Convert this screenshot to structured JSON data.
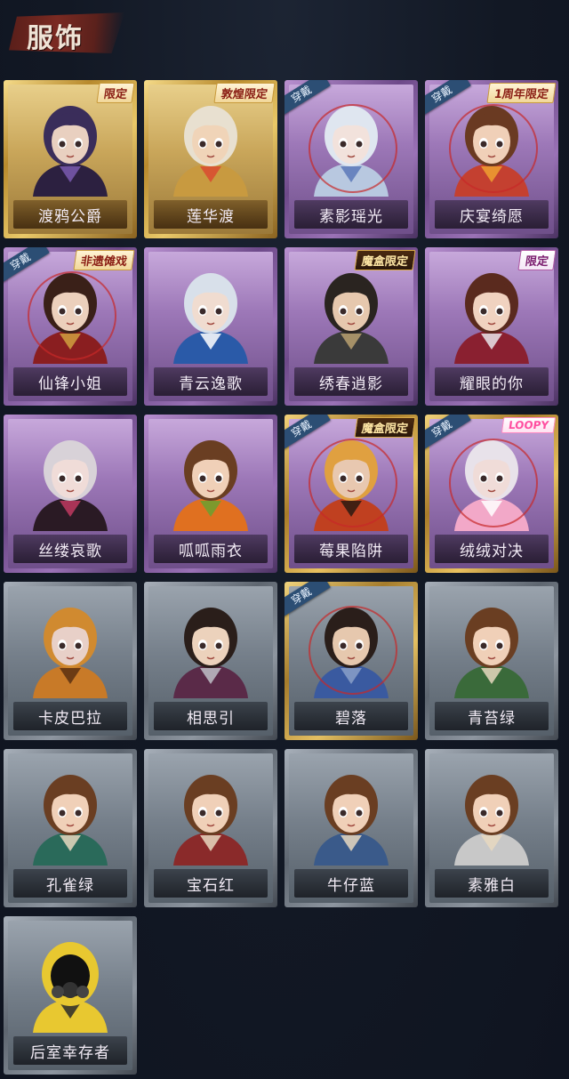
{
  "header": {
    "title": "服饰"
  },
  "cards": [
    {
      "name": "渡鸦公爵",
      "rarity": "gold",
      "badge": "限定",
      "badge_style": "light",
      "equipped": false,
      "hair": "#3a2d5a",
      "skin": "#e9d0c0",
      "cloth": "#2c2040",
      "accent": "#7a5ab0"
    },
    {
      "name": "莲华渡",
      "rarity": "gold",
      "badge": "敦煌限定",
      "badge_style": "light",
      "equipped": false,
      "hair": "#e8e0d0",
      "skin": "#f0d4b8",
      "cloth": "#c89a40",
      "accent": "#d94a30"
    },
    {
      "name": "素影瑶光",
      "rarity": "purple",
      "badge": "",
      "badge_style": "",
      "equipped": true,
      "hair": "#dfe6f0",
      "skin": "#f2e2dc",
      "cloth": "#b8c8e0",
      "accent": "#5a78b8"
    },
    {
      "name": "庆宴绮愿",
      "rarity": "purple",
      "badge": "1周年限定",
      "badge_style": "light",
      "equipped": true,
      "hair": "#6a3a22",
      "skin": "#f0d0b8",
      "cloth": "#c44030",
      "accent": "#f0a030"
    },
    {
      "name": "仙锋小姐",
      "rarity": "purple",
      "badge": "非遗傩戏",
      "badge_style": "light",
      "equipped": true,
      "hair": "#3a2018",
      "skin": "#ecd0bc",
      "cloth": "#8a1e20",
      "accent": "#d0a040"
    },
    {
      "name": "青云逸歌",
      "rarity": "purple",
      "badge": "",
      "badge_style": "",
      "equipped": false,
      "hair": "#d8e0ea",
      "skin": "#f0dcd0",
      "cloth": "#2a5aa8",
      "accent": "#ffffff"
    },
    {
      "name": "绣春逍影",
      "rarity": "purple",
      "badge": "魔盒限定",
      "badge_style": "dark",
      "equipped": false,
      "hair": "#2a2420",
      "skin": "#e6c8ae",
      "cloth": "#3a3a3a",
      "accent": "#b8a070"
    },
    {
      "name": "耀眼的你",
      "rarity": "purple",
      "badge": "限定",
      "badge_style": "purple",
      "equipped": false,
      "hair": "#5a2a1e",
      "skin": "#f0d2c0",
      "cloth": "#8a2030",
      "accent": "#e8e6ea"
    },
    {
      "name": "丝缕哀歌",
      "rarity": "purple",
      "badge": "",
      "badge_style": "",
      "equipped": false,
      "hair": "#d8d2d8",
      "skin": "#f0dcd8",
      "cloth": "#2a1a24",
      "accent": "#c03a60"
    },
    {
      "name": "呱呱雨衣",
      "rarity": "purple",
      "badge": "",
      "badge_style": "",
      "equipped": false,
      "hair": "#6a3e22",
      "skin": "#f0d0b8",
      "cloth": "#e07020",
      "accent": "#6aa030"
    },
    {
      "name": "莓果陷阱",
      "rarity": "purple",
      "goldedge": true,
      "badge": "魔盒限定",
      "badge_style": "dark",
      "equipped": true,
      "hair": "#e0a040",
      "skin": "#e8c8b0",
      "cloth": "#c04020",
      "accent": "#2a1a12"
    },
    {
      "name": "绒绒对决",
      "rarity": "purple",
      "goldedge": true,
      "badge": "LOOPY",
      "badge_style": "pink",
      "equipped": true,
      "hair": "#e8e2ea",
      "skin": "#f0dcd8",
      "cloth": "#f2a8c8",
      "accent": "#ffffff"
    },
    {
      "name": "卡皮巴拉",
      "rarity": "grey",
      "badge": "",
      "badge_style": "",
      "equipped": false,
      "hair": "#d08a30",
      "skin": "#e8d0c8",
      "cloth": "#c87a28",
      "accent": "#5a3010"
    },
    {
      "name": "相思引",
      "rarity": "grey",
      "badge": "",
      "badge_style": "",
      "equipped": false,
      "hair": "#2a1e1a",
      "skin": "#ecd2bc",
      "cloth": "#5a2a48",
      "accent": "#c0c0c8"
    },
    {
      "name": "碧落",
      "rarity": "grey",
      "goldedge": true,
      "badge": "",
      "badge_style": "",
      "equipped": true,
      "hair": "#2a1e1a",
      "skin": "#e6c8ae",
      "cloth": "#3a5aa0",
      "accent": "#8aa0c8"
    },
    {
      "name": "青苔绿",
      "rarity": "grey",
      "badge": "",
      "badge_style": "",
      "equipped": false,
      "hair": "#6a3e22",
      "skin": "#f0d0b8",
      "cloth": "#3a6a3a",
      "accent": "#e8d8c0"
    },
    {
      "name": "孔雀绿",
      "rarity": "grey",
      "badge": "",
      "badge_style": "",
      "equipped": false,
      "hair": "#6a3e22",
      "skin": "#f0d0b8",
      "cloth": "#2a6a5a",
      "accent": "#e8d8c0"
    },
    {
      "name": "宝石红",
      "rarity": "grey",
      "badge": "",
      "badge_style": "",
      "equipped": false,
      "hair": "#6a3e22",
      "skin": "#f0d0b8",
      "cloth": "#8a2a2a",
      "accent": "#e8d8c0"
    },
    {
      "name": "牛仔蓝",
      "rarity": "grey",
      "badge": "",
      "badge_style": "",
      "equipped": false,
      "hair": "#6a3e22",
      "skin": "#f0d0b8",
      "cloth": "#3a5a8a",
      "accent": "#e8d8c0"
    },
    {
      "name": "素雅白",
      "rarity": "grey",
      "badge": "",
      "badge_style": "",
      "equipped": false,
      "hair": "#6a3e22",
      "skin": "#f0d0b8",
      "cloth": "#c8c8c8",
      "accent": "#e8d8c0"
    },
    {
      "name": "后室幸存者",
      "rarity": "grey",
      "badge": "",
      "badge_style": "",
      "equipped": false,
      "hair": "#e8c830",
      "skin": "#1a1a1a",
      "cloth": "#e8c830",
      "accent": "#2a2a2a",
      "mask": true
    }
  ],
  "equipped_label": "穿戴"
}
